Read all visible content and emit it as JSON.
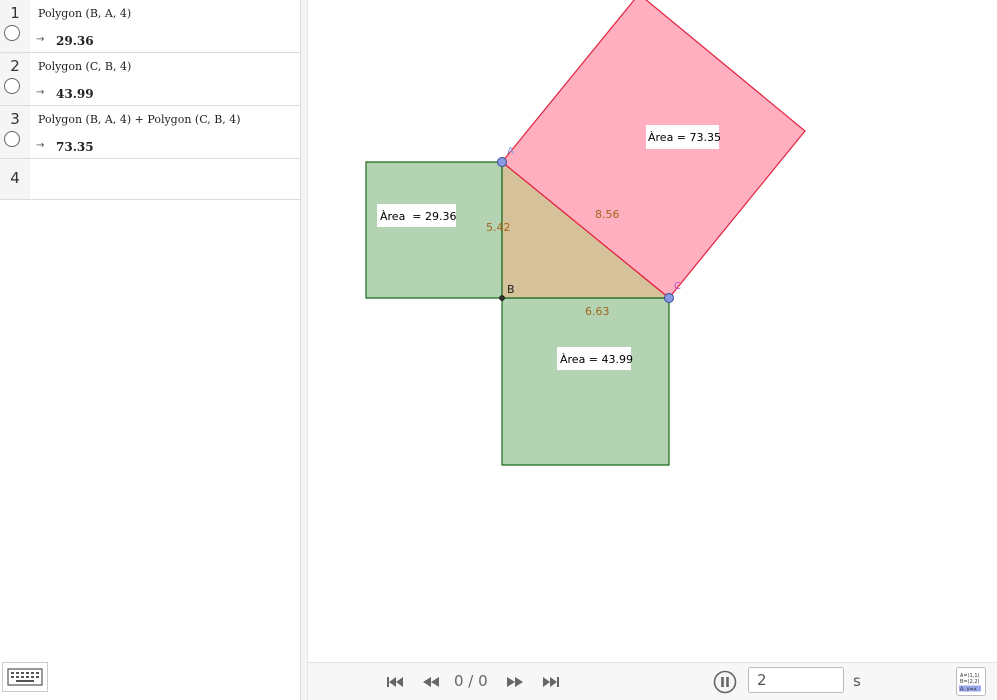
{
  "algebra": {
    "rows": [
      {
        "num": "1",
        "definition": "Polygon (B, A, 4)",
        "arrow": "→",
        "value": "29.36"
      },
      {
        "num": "2",
        "definition": "Polygon (C, B, 4)",
        "arrow": "→",
        "value": "43.99"
      },
      {
        "num": "3",
        "definition": "Polygon (B, A, 4) + Polygon (C, B, 4)",
        "arrow": "→",
        "value": "73.35"
      },
      {
        "num": "4"
      }
    ]
  },
  "graphics": {
    "points": {
      "A": "A",
      "B": "B",
      "C": "C"
    },
    "segments": {
      "ab": "5.42",
      "bc": "6.63",
      "ac": "8.56"
    },
    "area_labels": {
      "left_square": "Àrea  = 29.36",
      "bottom_square": "Àrea = 43.99",
      "hyp_square": "Àrea = 73.35"
    },
    "colors": {
      "green_fill": "#b3d3b3",
      "green_stroke": "#1b6a1b",
      "pink_fill": "#ffafc0",
      "pink_stroke": "#e2213c",
      "triangle_fill": "#d6c29a",
      "label_brown": "#a0661a",
      "point_fill": "#8a9ae0"
    }
  },
  "playback": {
    "counter": "0 / 0",
    "speed": "2",
    "unit": "s",
    "icons": [
      "skip-first-icon",
      "step-back-icon",
      "step-forward-icon",
      "skip-last-icon",
      "pause-icon"
    ]
  },
  "toggle_icon_text": [
    "A=(1,1)",
    "B=(2,2)",
    "A, y=x"
  ]
}
